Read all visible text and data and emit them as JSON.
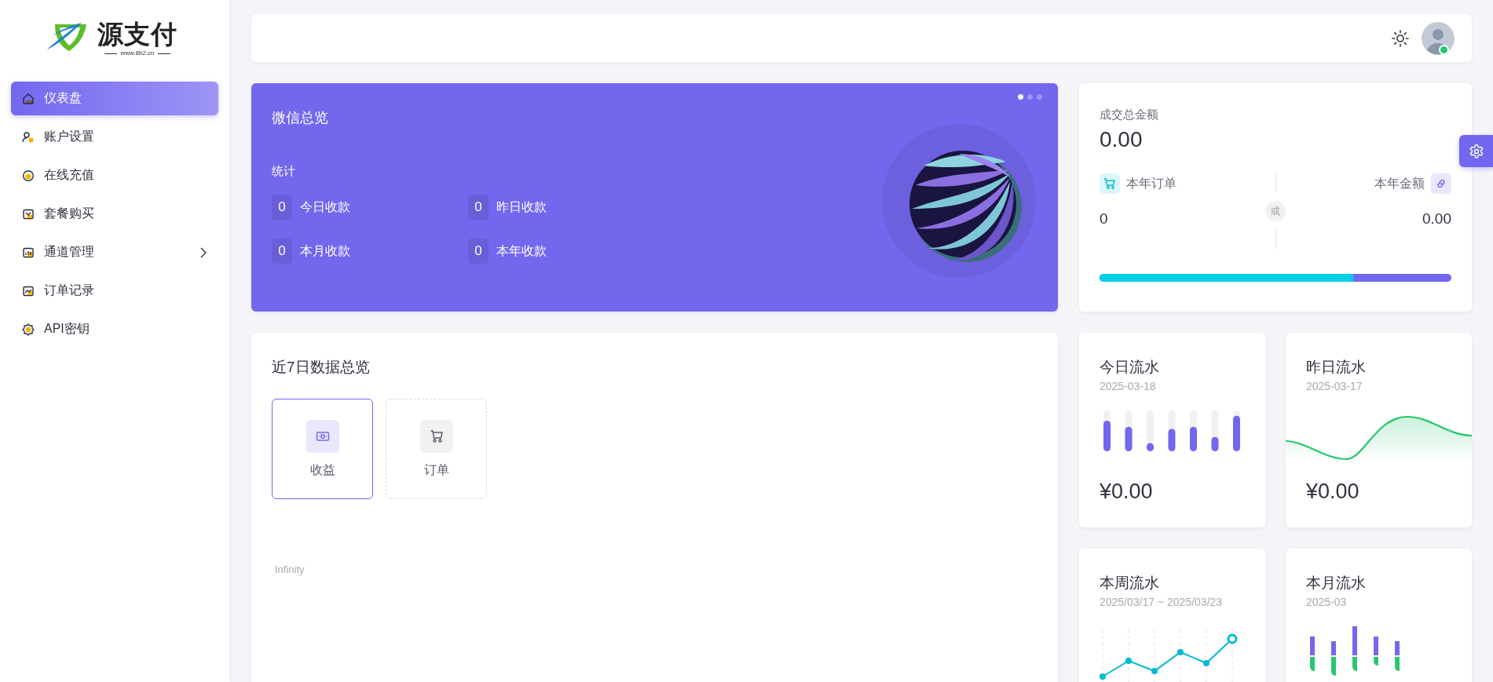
{
  "logo": {
    "name": "源支付",
    "url": "www.8b2.cn"
  },
  "sidebar": {
    "items": [
      {
        "label": "仪表盘",
        "kind": "link",
        "selected": true
      },
      {
        "label": "账户设置",
        "kind": "link",
        "selected": false
      },
      {
        "label": "在线充值",
        "kind": "link",
        "selected": false
      },
      {
        "label": "套餐购买",
        "kind": "link",
        "selected": false
      },
      {
        "label": "通道管理",
        "kind": "group",
        "selected": false
      },
      {
        "label": "订单记录",
        "kind": "link",
        "selected": false
      },
      {
        "label": "API密钥",
        "kind": "link",
        "selected": false
      }
    ]
  },
  "topbar": {
    "user_online": true
  },
  "wechat_overview": {
    "title": "微信总览",
    "carousel_dots": [
      {
        "selected": true
      },
      {
        "selected": false
      },
      {
        "selected": false
      }
    ],
    "section_label": "统计",
    "stats": [
      {
        "value": "0",
        "label": "今日收款"
      },
      {
        "value": "0",
        "label": "昨日收款"
      },
      {
        "value": "0",
        "label": "本月收款"
      },
      {
        "value": "0",
        "label": "本年收款"
      }
    ]
  },
  "total": {
    "label": "成交总金额",
    "value": "0.00",
    "orders": {
      "label": "本年订单",
      "value": "0"
    },
    "divider_text": "或",
    "amount": {
      "label": "本年金额",
      "value": "0.00"
    },
    "level": 0.72
  },
  "overview": {
    "title": "近7日数据总览",
    "tabs": [
      {
        "label": "收益",
        "selected": true
      },
      {
        "label": "订单",
        "selected": false
      }
    ],
    "chart_label": "Infinity"
  },
  "flow_cards": [
    {
      "title": "今日流水",
      "date": "2025-03-18",
      "kind": "bars",
      "amount": "¥0.00"
    },
    {
      "title": "昨日流水",
      "date": "2025-03-17",
      "kind": "wave",
      "amount": "¥0.00"
    },
    {
      "title": "本周流水",
      "date": "2025/03/17 ~ 2025/03/23",
      "kind": "line"
    },
    {
      "title": "本月流水",
      "date": "2025-03",
      "kind": "stacked"
    }
  ]
}
